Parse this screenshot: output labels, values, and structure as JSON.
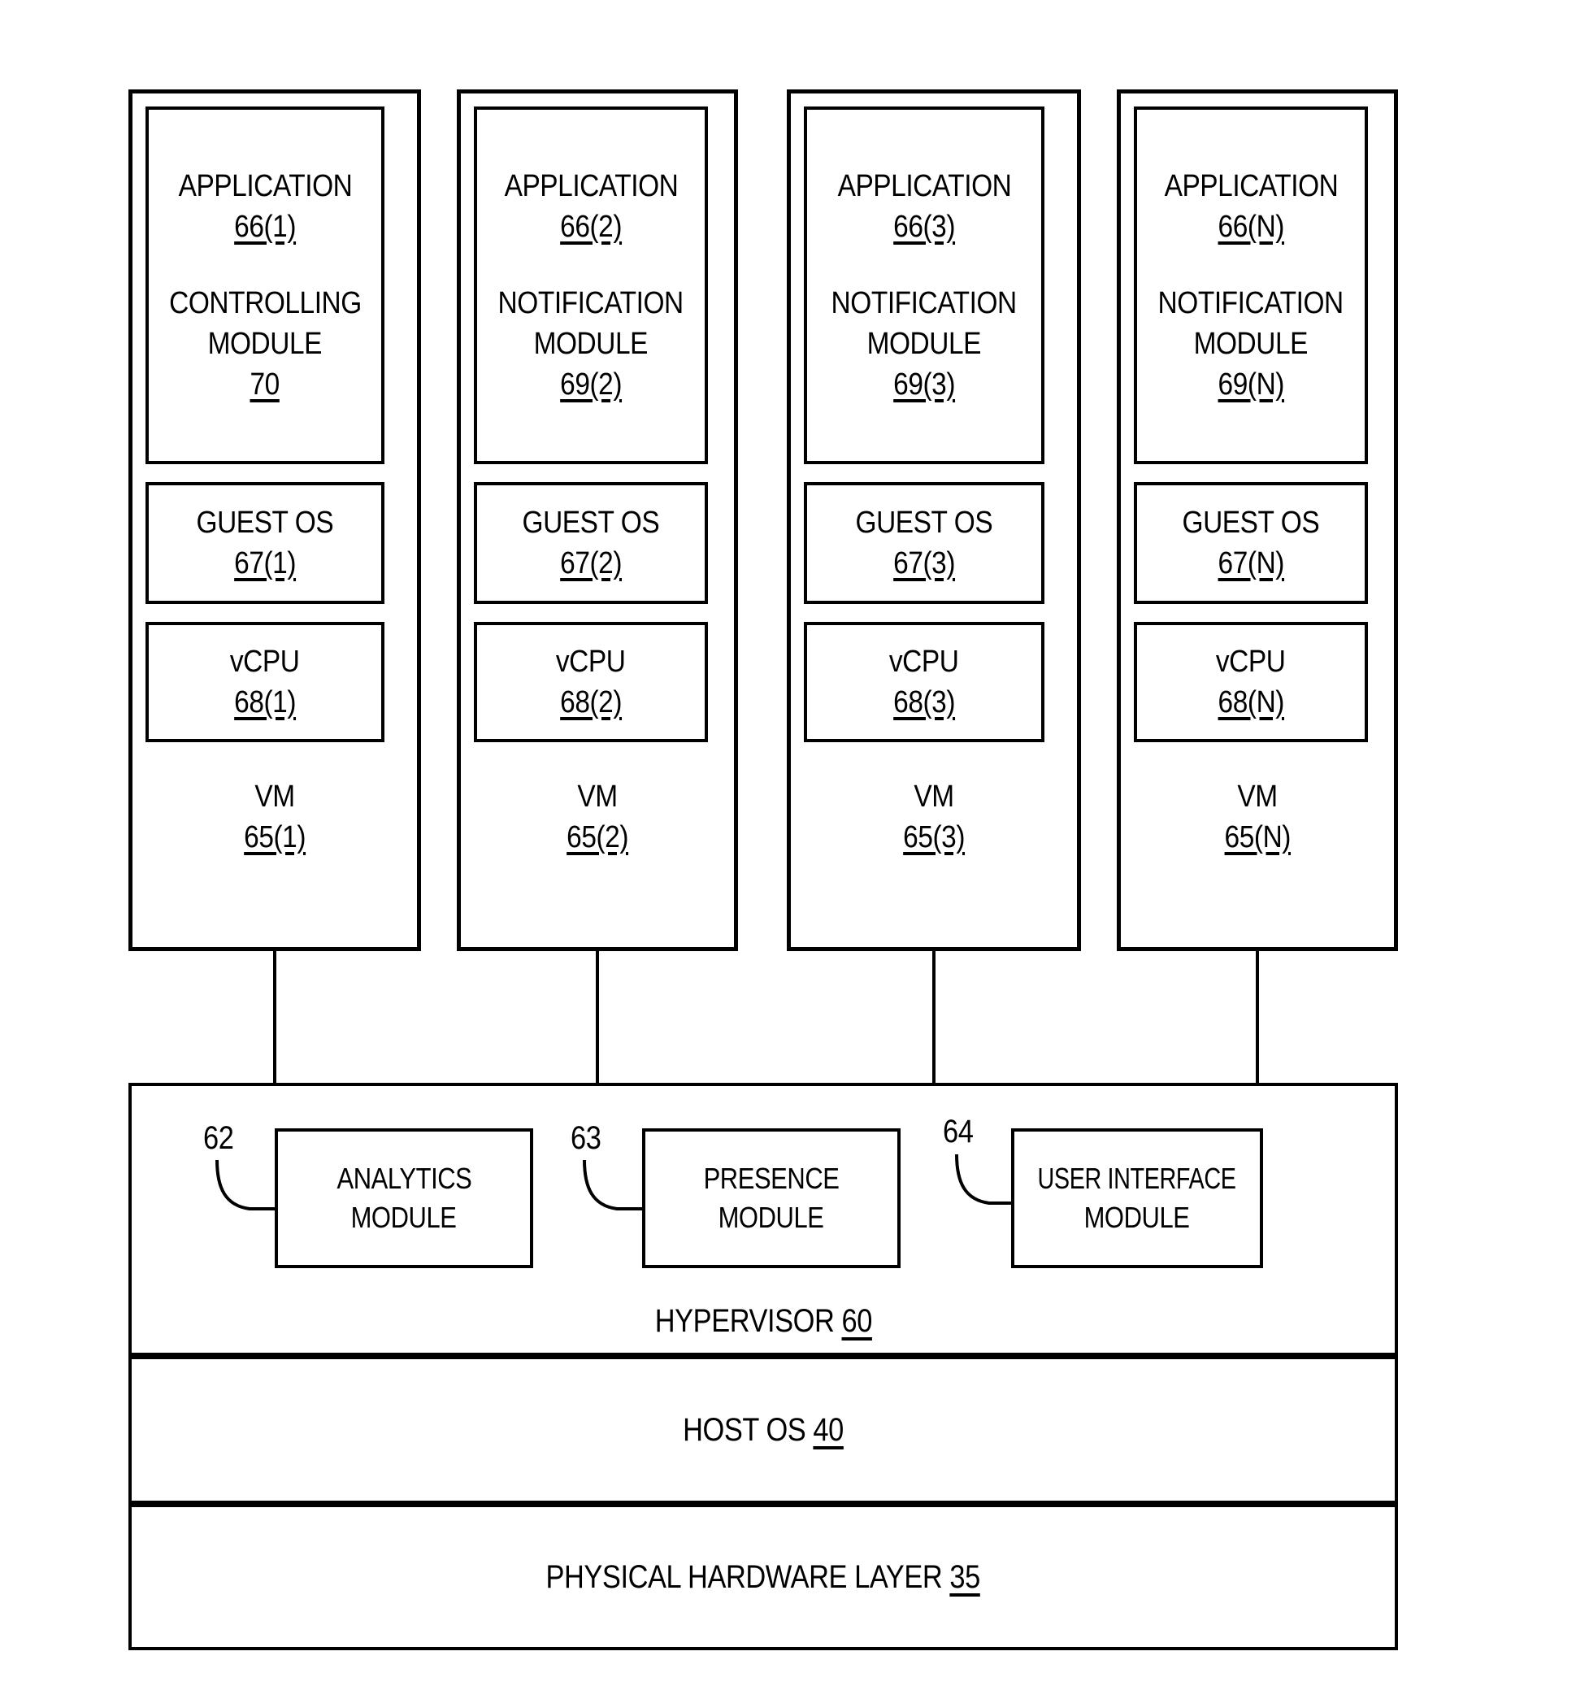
{
  "figure": {
    "title": "Virtualization architecture block diagram",
    "stroke_color": "#000000",
    "background_color": "#ffffff"
  },
  "vms": [
    {
      "app_label": "APPLICATION",
      "app_ref": "66(1)",
      "module_label_line1": "CONTROLLING",
      "module_label_line2": "MODULE",
      "module_ref": "70",
      "guest_os_label": "GUEST OS",
      "guest_os_ref": "67(1)",
      "vcpu_label": "vCPU",
      "vcpu_ref": "68(1)",
      "vm_label": "VM",
      "vm_ref": "65(1)"
    },
    {
      "app_label": "APPLICATION",
      "app_ref": "66(2)",
      "module_label_line1": "NOTIFICATION",
      "module_label_line2": "MODULE",
      "module_ref": "69(2)",
      "guest_os_label": "GUEST OS",
      "guest_os_ref": "67(2)",
      "vcpu_label": "vCPU",
      "vcpu_ref": "68(2)",
      "vm_label": "VM",
      "vm_ref": "65(2)"
    },
    {
      "app_label": "APPLICATION",
      "app_ref": "66(3)",
      "module_label_line1": "NOTIFICATION",
      "module_label_line2": "MODULE",
      "module_ref": "69(3)",
      "guest_os_label": "GUEST OS",
      "guest_os_ref": "67(3)",
      "vcpu_label": "vCPU",
      "vcpu_ref": "68(3)",
      "vm_label": "VM",
      "vm_ref": "65(3)"
    },
    {
      "app_label": "APPLICATION",
      "app_ref": "66(N)",
      "module_label_line1": "NOTIFICATION",
      "module_label_line2": "MODULE",
      "module_ref": "69(N)",
      "guest_os_label": "GUEST OS",
      "guest_os_ref": "67(N)",
      "vcpu_label": "vCPU",
      "vcpu_ref": "68(N)",
      "vm_label": "VM",
      "vm_ref": "65(N)"
    }
  ],
  "hypervisor": {
    "caption_text": "HYPERVISOR ",
    "caption_ref": "60",
    "modules": [
      {
        "ref": "62",
        "line1": "ANALYTICS",
        "line2": "MODULE"
      },
      {
        "ref": "63",
        "line1": "PRESENCE",
        "line2": "MODULE"
      },
      {
        "ref": "64",
        "line1": "USER INTERFACE",
        "line2": "MODULE"
      }
    ]
  },
  "host_os": {
    "caption_text": "HOST OS ",
    "caption_ref": "40"
  },
  "physical_hardware": {
    "caption_text": "PHYSICAL HARDWARE LAYER ",
    "caption_ref": "35"
  }
}
